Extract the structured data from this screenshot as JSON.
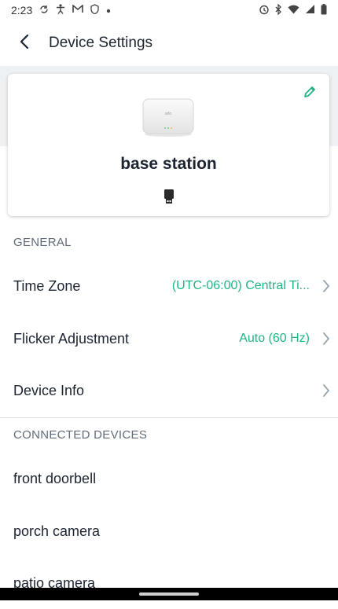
{
  "status_bar": {
    "time": "2:23",
    "left_icons": [
      "sync-icon",
      "accessibility-icon",
      "gmail-icon",
      "shield-icon",
      "dot-icon"
    ],
    "right_icons": [
      "alarm-icon",
      "bluetooth-icon",
      "wifi-icon",
      "signal-icon",
      "battery-icon"
    ]
  },
  "header": {
    "title": "Device Settings",
    "back_icon": "back-arrow-icon"
  },
  "device_card": {
    "name": "base station",
    "edit_icon": "pencil-icon",
    "device_type_icon": "usb-drive-icon",
    "device_logo_text": "arlo"
  },
  "general": {
    "header": "GENERAL",
    "rows": [
      {
        "label": "Time Zone",
        "value": "(UTC-06:00) Central Ti..."
      },
      {
        "label": "Flicker Adjustment",
        "value": "Auto (60 Hz)"
      },
      {
        "label": "Device Info",
        "value": ""
      }
    ]
  },
  "connected_devices": {
    "header": "CONNECTED DEVICES",
    "items": [
      {
        "label": "front doorbell"
      },
      {
        "label": "porch camera"
      },
      {
        "label": "patio camera"
      }
    ]
  },
  "colors": {
    "accent": "#1fb583",
    "title": "#1b2430",
    "section_header": "#5f6b77",
    "hero_background": "#eef1f3"
  }
}
